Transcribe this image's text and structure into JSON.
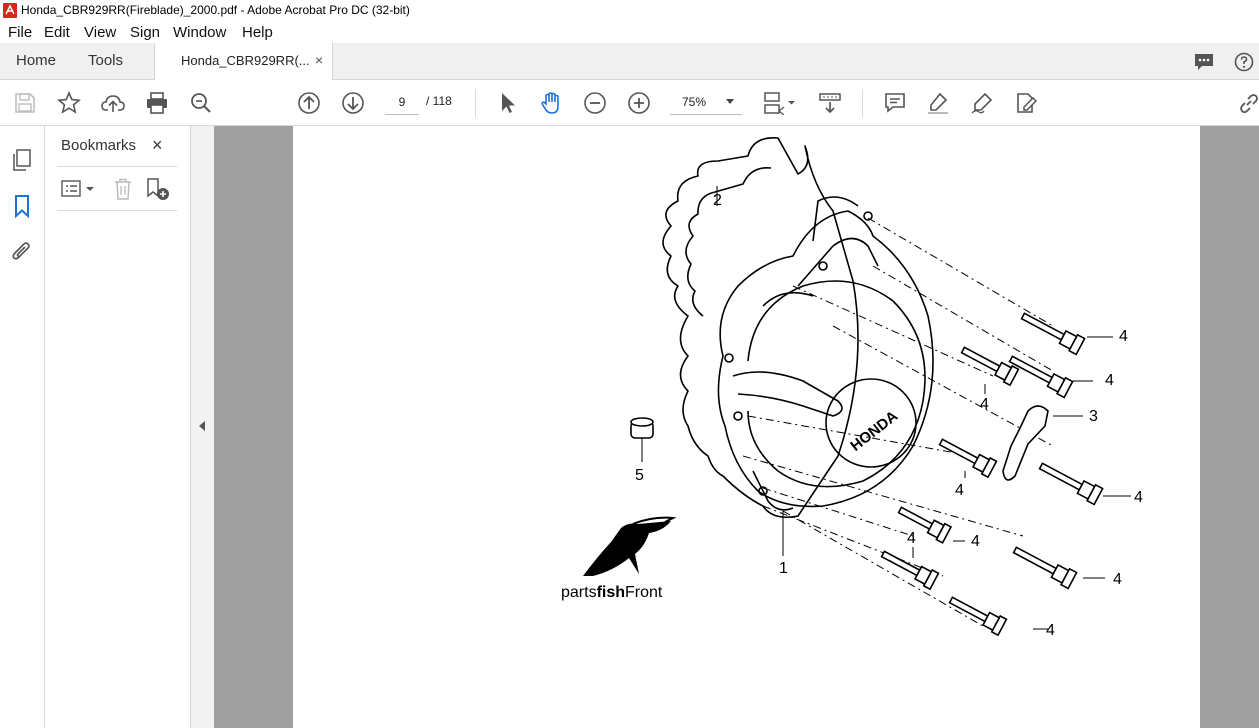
{
  "window": {
    "title": "Honda_CBR929RR(Fireblade)_2000.pdf - Adobe Acrobat Pro DC (32-bit)"
  },
  "menu": [
    "File",
    "Edit",
    "View",
    "Sign",
    "Window",
    "Help"
  ],
  "tabs": {
    "home": "Home",
    "tools": "Tools",
    "document": "Honda_CBR929RR(...",
    "close_glyph": "×"
  },
  "toolbar": {
    "page_current": "9",
    "page_total": "/ 118",
    "zoom": "75%"
  },
  "bookmarks_panel": {
    "title": "Bookmarks",
    "close_glyph": "×"
  },
  "page": {
    "callouts": [
      "2",
      "4",
      "4",
      "4",
      "3",
      "5",
      "4",
      "4",
      "4",
      "4",
      "1",
      "4",
      "4"
    ],
    "logo": {
      "prefix": "parts",
      "bold": "fish",
      "suffix": "Front"
    }
  },
  "colors": {
    "acrobat_red": "#d9261c",
    "accent_blue": "#1a73d9",
    "doc_bg": "#a0a0a0"
  }
}
